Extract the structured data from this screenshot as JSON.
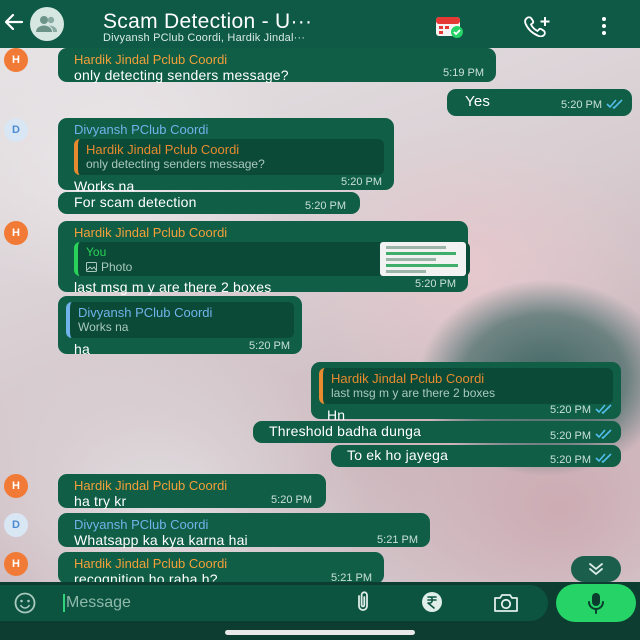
{
  "header": {
    "title": "Scam Detection - U···",
    "subtitle": "Divyansh PClub Coordi, Hardik Jindal···"
  },
  "messages": [
    {
      "sender": "Hardik Jindal Pclub Coordi",
      "avatar": "H",
      "text": "only detecting senders message?",
      "time": "5:19 PM"
    },
    {
      "text": "Yes",
      "time": "5:20 PM"
    },
    {
      "sender": "Divyansh PClub Coordi",
      "avatar": "D",
      "quote_sender": "Hardik Jindal Pclub Coordi",
      "quote_text": "only detecting senders message?",
      "text": "Works na",
      "time": "5:20 PM"
    },
    {
      "text": "For scam detection",
      "time": "5:20 PM"
    },
    {
      "sender": "Hardik Jindal Pclub Coordi",
      "avatar": "H",
      "quote_sender": "You",
      "quote_text": "Photo",
      "text": "last msg m y are there 2 boxes",
      "time": "5:20 PM"
    },
    {
      "quote_sender": "Divyansh PClub Coordi",
      "quote_text": "Works na",
      "text": "ha",
      "time": "5:20 PM"
    },
    {
      "quote_sender": "Hardik Jindal Pclub Coordi",
      "quote_text": "last msg m y are there 2 boxes",
      "text": "Hn",
      "time": "5:20 PM"
    },
    {
      "text": "Threshold badha dunga",
      "time": "5:20 PM"
    },
    {
      "text": "To ek ho jayega",
      "time": "5:20 PM"
    },
    {
      "sender": "Hardik Jindal Pclub Coordi",
      "avatar": "H",
      "text": "ha try kr",
      "time": "5:20 PM"
    },
    {
      "sender": "Divyansh PClub Coordi",
      "avatar": "D",
      "text": "Whatsapp ka kya karna hai",
      "time": "5:21 PM"
    },
    {
      "sender": "Hardik Jindal Pclub Coordi",
      "avatar": "H",
      "text": "recognition ho raha h?",
      "time": "5:21 PM"
    }
  ],
  "composer": {
    "placeholder": "Message"
  },
  "colors": {
    "header": "#0e5a46",
    "bubble": "#0f5e45",
    "accent_green": "#25d366",
    "sender_orange": "#f39f3a",
    "sender_blue": "#71b3ec"
  },
  "icons": [
    "back-arrow-icon",
    "group-icon",
    "calendar-icon",
    "call-add-icon",
    "menu-icon",
    "double-tick-icon",
    "photo-icon",
    "chevron-down-icon",
    "emoji-icon",
    "attach-icon",
    "rupee-icon",
    "camera-icon",
    "mic-icon"
  ]
}
